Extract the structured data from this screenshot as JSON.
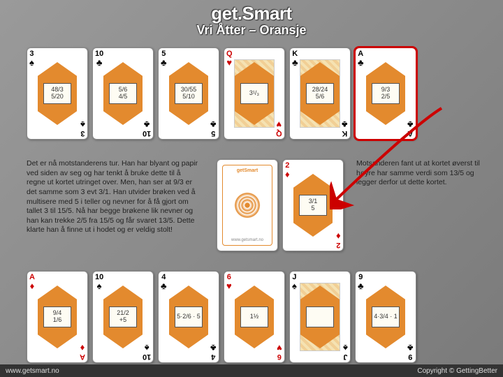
{
  "header": {
    "title": "get.Smart",
    "subtitle": "Vri Åtter – Oransje"
  },
  "rows": {
    "top": [
      {
        "rank": "3",
        "suit": "♠",
        "color": "black",
        "fraction": "48/3\n5/20"
      },
      {
        "rank": "10",
        "suit": "♣",
        "color": "black",
        "fraction": "5/6\n4/5"
      },
      {
        "rank": "5",
        "suit": "♣",
        "color": "black",
        "fraction": "30/55\n5/10"
      },
      {
        "rank": "Q",
        "suit": "♥",
        "color": "red",
        "fraction": "3¹/₃",
        "face": true
      },
      {
        "rank": "K",
        "suit": "♣",
        "color": "black",
        "fraction": "28/24\n5/6",
        "face": true
      },
      {
        "rank": "A",
        "suit": "♣",
        "color": "black",
        "fraction": "9/3\n2/5",
        "selected": true
      }
    ],
    "mid": [
      {
        "back": true,
        "brand": "getSmart",
        "site": "www.getsmart.no"
      },
      {
        "rank": "2",
        "suit": "♦",
        "color": "red",
        "fraction": "3/1\n5"
      }
    ],
    "bot": [
      {
        "rank": "A",
        "suit": "♦",
        "color": "red",
        "fraction": "9/4\n1/6"
      },
      {
        "rank": "10",
        "suit": "♠",
        "color": "black",
        "fraction": "21/2\n+5"
      },
      {
        "rank": "4",
        "suit": "♣",
        "color": "black",
        "fraction": "5·2/6 · 5"
      },
      {
        "rank": "6",
        "suit": "♥",
        "color": "red",
        "fraction": "1½"
      },
      {
        "rank": "J",
        "suit": "♠",
        "color": "black",
        "fraction": "",
        "face": true
      },
      {
        "rank": "9",
        "suit": "♣",
        "color": "black",
        "fraction": "4·3/4 · 1"
      }
    ]
  },
  "text": {
    "left": "Det er nå motstanderens tur. Han har blyant og papir ved siden av seg og har tenkt å bruke dette til å regne ut kortet utringet over. Men, han ser at 9/3 er det samme som 3 evt 3/1. Han utvider brøken ved å multisere med 5 i teller og nevner for å få gjort om tallet 3 til 15/5.\nNå har begge brøkene lik nevner og han kan trekke 2/5 fra 15/5 og får svaret 13/5. Dette klarte han å finne ut i hodet og er veldig stolt!",
    "right": "Motsanderen fant ut at kortet øverst til høyre har samme verdi som 13/5 og legger derfor ut dette kortet."
  },
  "footer": {
    "left": "www.getsmart.no",
    "right": "Copyright © GettingBetter"
  }
}
